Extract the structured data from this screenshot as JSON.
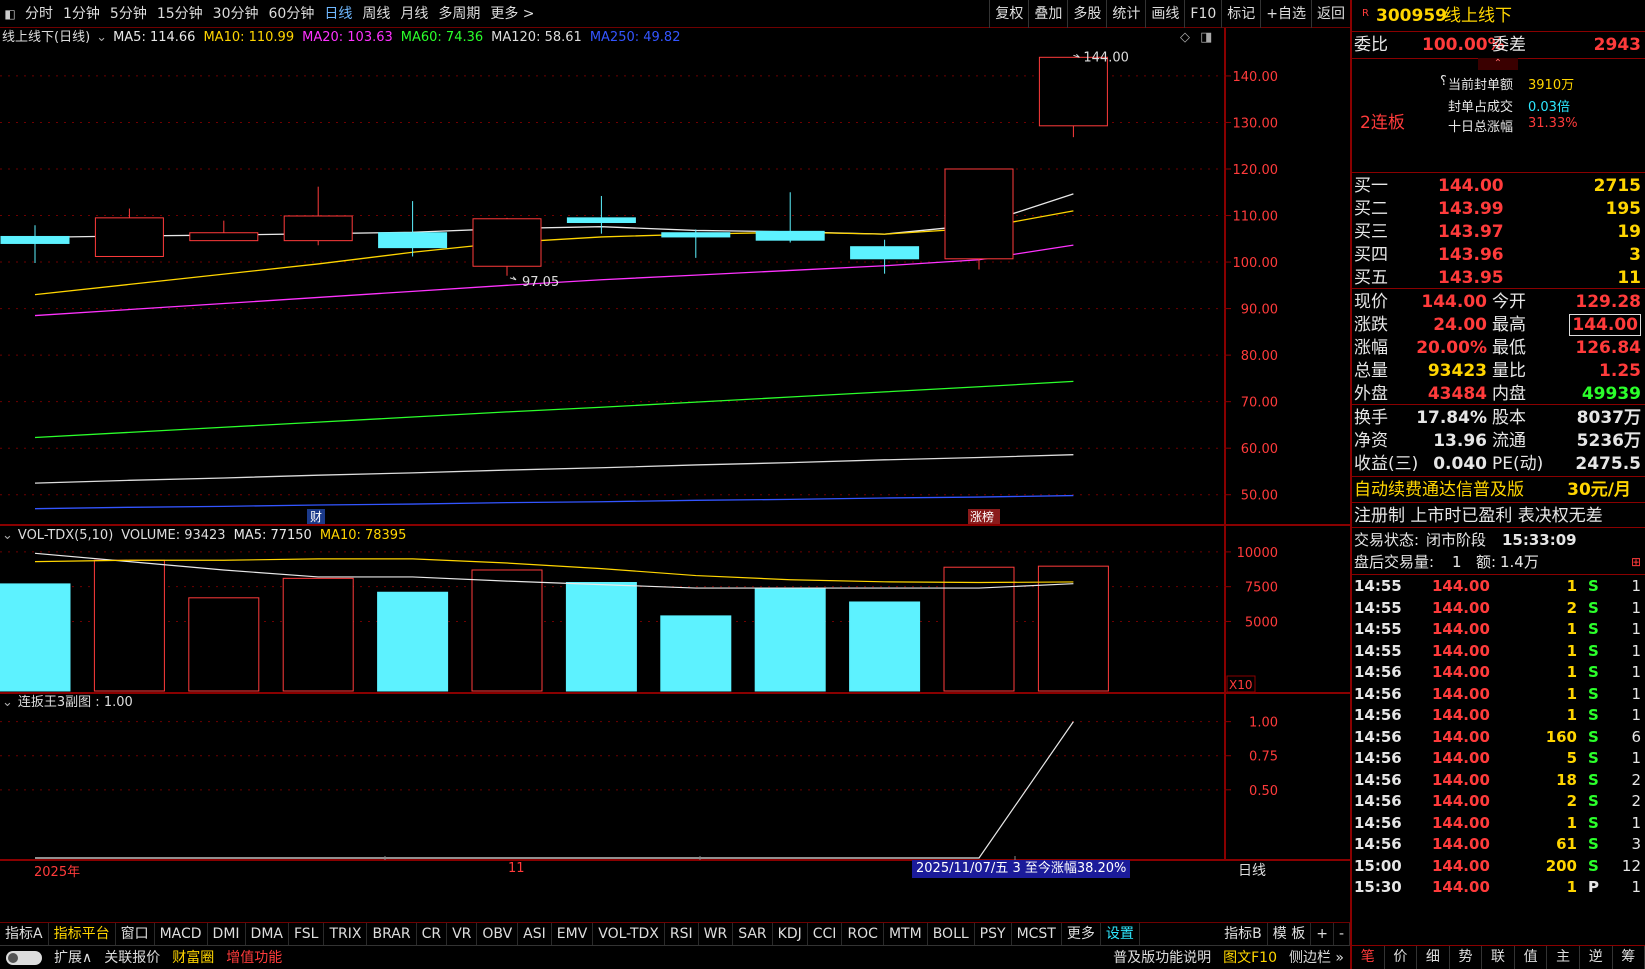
{
  "topbar": {
    "tabs": [
      "分时",
      "1分钟",
      "5分钟",
      "15分钟",
      "30分钟",
      "60分钟",
      "日线",
      "周线",
      "月线",
      "多周期",
      "更多 >"
    ],
    "active_tab": "日线",
    "tools": [
      "复权",
      "叠加",
      "多股",
      "统计",
      "画线",
      "F10",
      "标记",
      "+自选",
      "返回"
    ]
  },
  "main_chart": {
    "title": "线上线下(日线)",
    "ma_legend": [
      {
        "label": "MA5: 114.66",
        "color": "#e8e8e8"
      },
      {
        "label": "MA10: 110.99",
        "color": "#ffd500"
      },
      {
        "label": "MA20: 103.63",
        "color": "#ff33ff"
      },
      {
        "label": "MA60: 74.36",
        "color": "#2bff2b"
      },
      {
        "label": "MA120: 58.61",
        "color": "#dddddd"
      },
      {
        "label": "MA250: 49.82",
        "color": "#3355ff"
      }
    ],
    "marks": {
      "high_label": "144.00",
      "low_label": "97.05",
      "cai": "财",
      "zhangbang": "涨榜"
    }
  },
  "chart_data": [
    {
      "type": "candlestick",
      "title": "线上线下(日线)",
      "ylim": [
        45,
        146
      ],
      "yticks": [
        50,
        60,
        70,
        80,
        90,
        100,
        110,
        120,
        130,
        140
      ],
      "ytick_labels": [
        "50.00",
        "60.00",
        "70.00",
        "80.00",
        "90.00",
        "100.00",
        "110.00",
        "120.00",
        "130.00",
        "140.00"
      ],
      "candles": [
        {
          "o": 105.5,
          "h": 107.9,
          "l": 99.8,
          "c": 104.0
        },
        {
          "o": 101.2,
          "h": 111.5,
          "l": 101.2,
          "c": 109.5
        },
        {
          "o": 104.6,
          "h": 108.9,
          "l": 104.6,
          "c": 106.3
        },
        {
          "o": 104.6,
          "h": 116.2,
          "l": 103.6,
          "c": 109.9
        },
        {
          "o": 106.3,
          "h": 113.1,
          "l": 101.2,
          "c": 103.1
        },
        {
          "o": 99.1,
          "h": 109.5,
          "l": 97.05,
          "c": 109.3
        },
        {
          "o": 109.5,
          "h": 114.2,
          "l": 106.1,
          "c": 108.5
        },
        {
          "o": 106.3,
          "h": 107.0,
          "l": 100.9,
          "c": 105.4
        },
        {
          "o": 106.6,
          "h": 115.0,
          "l": 104.2,
          "c": 104.7
        },
        {
          "o": 103.3,
          "h": 104.8,
          "l": 97.5,
          "c": 100.7
        },
        {
          "o": 100.7,
          "h": 120.0,
          "l": 98.4,
          "c": 120.0
        },
        {
          "o": 129.28,
          "h": 144.0,
          "l": 126.84,
          "c": 144.0
        }
      ],
      "series": [
        {
          "name": "MA5",
          "color": "#e8e8e8",
          "values": [
            105.3,
            105.6,
            105.8,
            106.1,
            106.4,
            107.2,
            107.6,
            106.8,
            106.5,
            106.0,
            108.0,
            114.66
          ]
        },
        {
          "name": "MA10",
          "color": "#ffd500",
          "values": [
            93.0,
            95.2,
            97.4,
            99.6,
            102.1,
            104.2,
            105.4,
            106.0,
            106.4,
            106.0,
            107.3,
            110.99
          ]
        },
        {
          "name": "MA20",
          "color": "#ff33ff",
          "values": [
            88.5,
            89.8,
            91.1,
            92.4,
            93.7,
            95.0,
            96.2,
            97.2,
            98.2,
            99.2,
            100.5,
            103.63
          ]
        },
        {
          "name": "MA60",
          "color": "#2bff2b",
          "values": [
            62.3,
            63.4,
            64.5,
            65.6,
            66.7,
            67.8,
            68.8,
            69.9,
            71.0,
            72.1,
            73.2,
            74.36
          ]
        },
        {
          "name": "MA120",
          "color": "#dddddd",
          "values": [
            52.5,
            53.1,
            53.6,
            54.2,
            54.7,
            55.3,
            55.8,
            56.4,
            56.9,
            57.5,
            58.0,
            58.61
          ]
        },
        {
          "name": "MA250",
          "color": "#3355ff",
          "values": [
            47.0,
            47.3,
            47.5,
            47.8,
            48.0,
            48.3,
            48.5,
            48.8,
            49.0,
            49.3,
            49.5,
            49.82
          ]
        }
      ]
    },
    {
      "type": "bar",
      "title": "VOL-TDX(5,10)",
      "ylim": [
        0,
        11000
      ],
      "yticks": [
        5000,
        7500,
        10000
      ],
      "ytick_labels": [
        "5000",
        "7500",
        "10000"
      ],
      "unit_label": "X10",
      "values": [
        7700,
        9400,
        6700,
        8100,
        7100,
        8700,
        7800,
        5400,
        7400,
        6400,
        8900,
        8975
      ],
      "up": [
        false,
        true,
        true,
        true,
        false,
        true,
        false,
        false,
        false,
        false,
        true,
        true
      ],
      "series": [
        {
          "name": "MA5",
          "color": "#e8e8e8",
          "values": [
            9900,
            9300,
            8700,
            8200,
            8200,
            7900,
            7650,
            7400,
            7400,
            7400,
            7400,
            7715
          ]
        },
        {
          "name": "MA10",
          "color": "#ffd500",
          "values": [
            9300,
            9400,
            9400,
            9500,
            9500,
            9200,
            8800,
            8300,
            8000,
            7850,
            7800,
            7840
          ]
        }
      ]
    },
    {
      "type": "line",
      "title": "连扳王3副图",
      "ylim": [
        0.0,
        1.1
      ],
      "yticks": [
        0.5,
        0.75,
        1.0
      ],
      "ytick_labels": [
        "0.50",
        "0.75",
        "1.00"
      ],
      "x": [
        0,
        1,
        2,
        3,
        4,
        5,
        6,
        7,
        8,
        9,
        10,
        11
      ],
      "values": [
        0,
        0,
        0,
        0,
        0,
        0,
        0,
        0,
        0,
        0,
        0,
        1.0
      ],
      "color": "#e8e8e8"
    }
  ],
  "vol_legend": {
    "title": "VOL-TDX(5,10)",
    "volume": "VOLUME: 93423",
    "ma5": "MA5: 77150",
    "ma10": "MA10: 78395"
  },
  "sub_legend": {
    "title": "连扳王3副图 : 1.00"
  },
  "xaxis": {
    "year": "2025年",
    "month": "11",
    "info": "2025/11/07/五 3 至今涨幅38.20%",
    "period": "日线"
  },
  "right_panel": {
    "code": "300959",
    "name": "线上线下",
    "r_badge": "R",
    "weibi_label": "委比",
    "weibi": "100.00%",
    "weicha_label": "委差",
    "weicha": "2943",
    "fengdan_label": "当前封单额",
    "fengdan": "3910万",
    "zhanbi_label": "封单占成交",
    "zhanbi": "0.03倍",
    "shiri_label": "十日总涨幅",
    "shiri": "31.33%",
    "lianban": "2连板",
    "bids": [
      {
        "label": "买一",
        "price": "144.00",
        "vol": "2715"
      },
      {
        "label": "买二",
        "price": "143.99",
        "vol": "195"
      },
      {
        "label": "买三",
        "price": "143.97",
        "vol": "19"
      },
      {
        "label": "买四",
        "price": "143.96",
        "vol": "3"
      },
      {
        "label": "买五",
        "price": "143.95",
        "vol": "11"
      }
    ],
    "quote": [
      {
        "l1": "现价",
        "v1": "144.00",
        "l2": "今开",
        "v2": "129.28"
      },
      {
        "l1": "涨跌",
        "v1": "24.00",
        "l2": "最高",
        "v2": "144.00"
      },
      {
        "l1": "涨幅",
        "v1": "20.00%",
        "l2": "最低",
        "v2": "126.84"
      },
      {
        "l1": "总量",
        "v1": "93423",
        "l2": "量比",
        "v2": "1.25"
      },
      {
        "l1": "外盘",
        "v1": "43484",
        "l2": "内盘",
        "v2": "49939"
      }
    ],
    "fund": [
      {
        "l1": "换手",
        "v1": "17.84%",
        "l2": "股本",
        "v2": "8037万"
      },
      {
        "l1": "净资",
        "v1": "13.96",
        "l2": "流通",
        "v2": "5236万"
      },
      {
        "l1": "收益(三)",
        "v1": "0.040",
        "l2": "PE(动)",
        "v2": "2475.5"
      }
    ],
    "promo": "自动续费通达信普及版",
    "promo_price": "30元/月",
    "tags": "注册制 上市时已盈利 表决权无差",
    "trade_status_label": "交易状态:",
    "trade_status": "闭市阶段",
    "trade_time": "15:33:09",
    "after_label": "盘后交易量:",
    "after_vol": "1",
    "after_amt_label": "额:",
    "after_amt": "1.4万",
    "ticks": [
      {
        "t": "14:55",
        "p": "144.00",
        "v": "1",
        "s": "S",
        "n": "1"
      },
      {
        "t": "14:55",
        "p": "144.00",
        "v": "2",
        "s": "S",
        "n": "1"
      },
      {
        "t": "14:55",
        "p": "144.00",
        "v": "1",
        "s": "S",
        "n": "1"
      },
      {
        "t": "14:55",
        "p": "144.00",
        "v": "1",
        "s": "S",
        "n": "1"
      },
      {
        "t": "14:56",
        "p": "144.00",
        "v": "1",
        "s": "S",
        "n": "1"
      },
      {
        "t": "14:56",
        "p": "144.00",
        "v": "1",
        "s": "S",
        "n": "1"
      },
      {
        "t": "14:56",
        "p": "144.00",
        "v": "1",
        "s": "S",
        "n": "1"
      },
      {
        "t": "14:56",
        "p": "144.00",
        "v": "160",
        "s": "S",
        "n": "6"
      },
      {
        "t": "14:56",
        "p": "144.00",
        "v": "5",
        "s": "S",
        "n": "1"
      },
      {
        "t": "14:56",
        "p": "144.00",
        "v": "18",
        "s": "S",
        "n": "2"
      },
      {
        "t": "14:56",
        "p": "144.00",
        "v": "2",
        "s": "S",
        "n": "2"
      },
      {
        "t": "14:56",
        "p": "144.00",
        "v": "1",
        "s": "S",
        "n": "1"
      },
      {
        "t": "14:56",
        "p": "144.00",
        "v": "61",
        "s": "S",
        "n": "3"
      },
      {
        "t": "15:00",
        "p": "144.00",
        "v": "200",
        "s": "S",
        "n": "12"
      },
      {
        "t": "15:30",
        "p": "144.00",
        "v": "1",
        "s": "P",
        "n": "1"
      }
    ],
    "bottom_tabs": [
      "笔",
      "价",
      "细",
      "势",
      "联",
      "值",
      "主",
      "逆",
      "筹"
    ]
  },
  "bottom_bar": {
    "indicators": [
      "指标A",
      "指标平台",
      "窗口",
      "MACD",
      "DMI",
      "DMA",
      "FSL",
      "TRIX",
      "BRAR",
      "CR",
      "VR",
      "OBV",
      "ASI",
      "EMV",
      "VOL-TDX",
      "RSI",
      "WR",
      "SAR",
      "KDJ",
      "CCI",
      "ROC",
      "MTM",
      "BOLL",
      "PSY",
      "MCST",
      "更多",
      "设置"
    ],
    "right_items": [
      "指标B",
      "模 板",
      "+",
      "-"
    ],
    "row2_left": [
      "扩展∧",
      "关联报价",
      "财富圈",
      "增值功能"
    ],
    "row2_right": [
      "普及版功能说明",
      "图文F10",
      "侧边栏 »"
    ]
  },
  "colors": {
    "up": "#ff3b3b",
    "down": "#5df2ff",
    "grid": "#6e0000",
    "axis": "#8a0000"
  }
}
